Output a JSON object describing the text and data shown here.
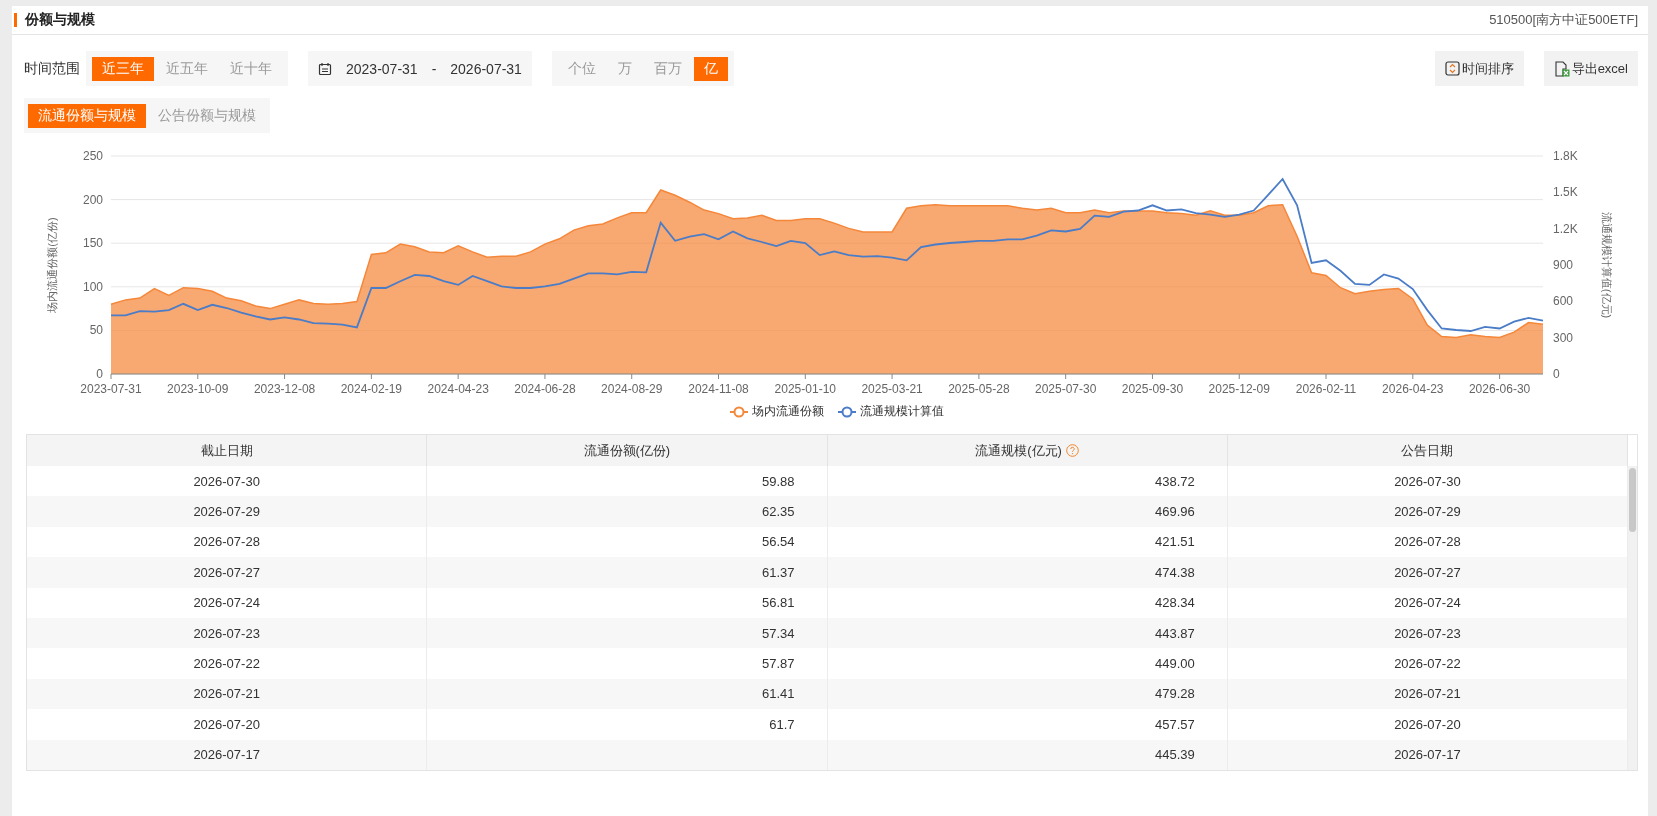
{
  "header": {
    "title": "份额与规模",
    "fund": "510500[南方中证500ETF]"
  },
  "time_range": {
    "label": "时间范围",
    "options": [
      {
        "label": "近三年",
        "selected": true
      },
      {
        "label": "近五年",
        "selected": false
      },
      {
        "label": "近十年",
        "selected": false
      }
    ]
  },
  "date_range": {
    "start": "2023-07-31",
    "separator": "-",
    "end": "2026-07-31"
  },
  "units": [
    {
      "label": "个位",
      "selected": false
    },
    {
      "label": "万",
      "selected": false
    },
    {
      "label": "百万",
      "selected": false
    },
    {
      "label": "亿",
      "selected": true
    }
  ],
  "actions": [
    {
      "label": "时间排序",
      "kind": "sort"
    },
    {
      "label": "导出excel",
      "kind": "excel"
    }
  ],
  "view_tabs": [
    {
      "label": "流通份额与规模",
      "selected": true
    },
    {
      "label": "公告份额与规模",
      "selected": false
    }
  ],
  "chart": {
    "chart_data": {
      "type": "area",
      "grid": true,
      "ylabel": "场内流通份额(亿份)",
      "y2label": "流通规模计算值(亿元)",
      "ylim": [
        0,
        250
      ],
      "y2lim": [
        0,
        1800
      ],
      "categories": [
        "2023-07-31",
        null,
        null,
        null,
        null,
        null,
        "2023-10-09",
        null,
        null,
        null,
        null,
        null,
        "2023-12-08",
        null,
        null,
        null,
        null,
        null,
        "2024-02-19",
        null,
        null,
        null,
        null,
        null,
        "2024-04-23",
        null,
        null,
        null,
        null,
        null,
        "2024-06-28",
        null,
        null,
        null,
        null,
        null,
        "2024-08-29",
        null,
        null,
        null,
        null,
        null,
        "2024-11-08",
        null,
        null,
        null,
        null,
        null,
        "2025-01-10",
        null,
        null,
        null,
        null,
        null,
        "2025-03-21",
        null,
        null,
        null,
        null,
        null,
        "2025-05-28",
        null,
        null,
        null,
        null,
        null,
        "2025-07-30",
        null,
        null,
        null,
        null,
        null,
        "2025-09-30",
        null,
        null,
        null,
        null,
        null,
        "2025-12-09",
        null,
        null,
        null,
        null,
        null,
        "2026-02-11",
        null,
        null,
        null,
        null,
        null,
        "2026-04-23",
        null,
        null,
        null,
        null,
        null,
        "2026-06-30",
        null,
        null,
        null
      ],
      "yticks": [
        0,
        50,
        100,
        150,
        200,
        250
      ],
      "y2ticks": [
        {
          "value": 0,
          "label": "0"
        },
        {
          "value": 300,
          "label": "300"
        },
        {
          "value": 600,
          "label": "600"
        },
        {
          "value": 900,
          "label": "900"
        },
        {
          "value": 1200,
          "label": "1.2K"
        },
        {
          "value": 1500,
          "label": "1.5K"
        },
        {
          "value": 1800,
          "label": "1.8K"
        }
      ],
      "series": [
        {
          "name": "场内流通份额",
          "color": "#f5873a",
          "values": [
            80,
            85,
            87,
            98,
            90,
            99,
            98,
            95,
            87,
            84,
            78,
            75,
            80,
            85,
            81,
            80,
            81,
            83,
            137,
            139,
            149,
            146,
            140,
            139,
            147,
            140,
            134,
            135,
            135,
            140,
            149,
            155,
            165,
            170,
            172,
            179,
            185,
            185,
            211,
            205,
            197,
            188,
            184,
            178,
            179,
            182,
            176,
            176,
            178,
            178,
            173,
            167,
            163,
            163,
            163,
            190,
            193,
            194,
            193,
            193,
            193,
            193,
            193,
            190,
            188,
            190,
            185,
            185,
            188,
            185,
            187,
            187,
            187,
            185,
            184,
            182,
            187,
            182,
            182,
            185,
            193,
            194,
            158,
            116,
            113,
            99,
            92,
            95,
            97,
            98,
            86,
            56,
            43,
            42,
            45,
            43,
            42,
            48,
            59,
            57
          ]
        },
        {
          "name": "流通规模计算值",
          "color": "#4a7cc7",
          "axis": "y2",
          "type": "line",
          "values": [
            485,
            485,
            519,
            515,
            528,
            580,
            528,
            571,
            545,
            506,
            476,
            450,
            467,
            450,
            420,
            415,
            407,
            385,
            710,
            710,
            766,
            818,
            809,
            766,
            736,
            809,
            766,
            723,
            710,
            710,
            723,
            744,
            788,
            831,
            831,
            822,
            844,
            840,
            1250,
            1100,
            1134,
            1155,
            1112,
            1177,
            1120,
            1090,
            1056,
            1099,
            1082,
            982,
            1012,
            982,
            969,
            973,
            960,
            939,
            1047,
            1069,
            1082,
            1090,
            1099,
            1099,
            1112,
            1112,
            1142,
            1186,
            1177,
            1199,
            1307,
            1298,
            1341,
            1350,
            1393,
            1350,
            1359,
            1328,
            1315,
            1298,
            1315,
            1350,
            1480,
            1610,
            1393,
            917,
            939,
            852,
            744,
            736,
            822,
            788,
            701,
            528,
            376,
            363,
            355,
            389,
            376,
            433,
            463,
            441
          ]
        }
      ]
    }
  },
  "table": {
    "columns": [
      {
        "label": "截止日期",
        "help": false
      },
      {
        "label": "流通份额(亿份)",
        "help": false
      },
      {
        "label": "流通规模(亿元)",
        "help": true
      },
      {
        "label": "公告日期",
        "help": false
      }
    ],
    "rows": [
      {
        "cells": [
          "2026-07-30",
          "59.88",
          "438.72",
          "2026-07-30"
        ]
      },
      {
        "cells": [
          "2026-07-29",
          "62.35",
          "469.96",
          "2026-07-29"
        ]
      },
      {
        "cells": [
          "2026-07-28",
          "56.54",
          "421.51",
          "2026-07-28"
        ]
      },
      {
        "cells": [
          "2026-07-27",
          "61.37",
          "474.38",
          "2026-07-27"
        ]
      },
      {
        "cells": [
          "2026-07-24",
          "56.81",
          "428.34",
          "2026-07-24"
        ]
      },
      {
        "cells": [
          "2026-07-23",
          "57.34",
          "443.87",
          "2026-07-23"
        ]
      },
      {
        "cells": [
          "2026-07-22",
          "57.87",
          "449.00",
          "2026-07-22"
        ]
      },
      {
        "cells": [
          "2026-07-21",
          "61.41",
          "479.28",
          "2026-07-21"
        ]
      },
      {
        "cells": [
          "2026-07-20",
          "61.7",
          "457.57",
          "2026-07-20"
        ]
      },
      {
        "cells": [
          "2026-07-17",
          null,
          "445.39",
          "2026-07-17"
        ]
      }
    ]
  }
}
